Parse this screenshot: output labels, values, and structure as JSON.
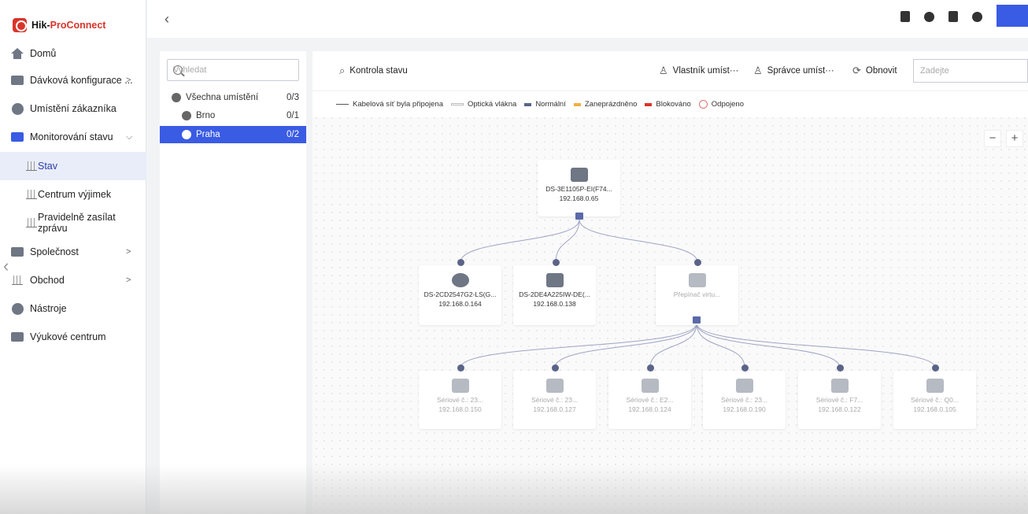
{
  "brand": {
    "hik": "Hik-",
    "pro": "ProConnect"
  },
  "sidebar": {
    "items": [
      {
        "label": "Domů",
        "icon": "home-icon"
      },
      {
        "label": "Dávková konfigurace ...",
        "icon": "batch-config-icon"
      },
      {
        "label": "Umístění zákazníka",
        "icon": "globe-icon"
      },
      {
        "label": "Monitorování stavu",
        "icon": "monitor-icon"
      },
      {
        "label": "Stav",
        "icon": "bar-chart-icon"
      },
      {
        "label": "Centrum výjimek",
        "icon": "bar-chart-icon"
      },
      {
        "label": "Pravidelně zasílat zprávu",
        "icon": "bar-chart-icon"
      },
      {
        "label": "Společnost",
        "icon": "company-icon"
      },
      {
        "label": "Obchod",
        "icon": "shop-icon"
      },
      {
        "label": "Nástroje",
        "icon": "tools-icon"
      },
      {
        "label": "Výukové centrum",
        "icon": "learning-icon"
      }
    ]
  },
  "tree": {
    "search_placeholder": "Vyhledat",
    "rows": [
      {
        "label": "Všechna umístění",
        "count": "0/3"
      },
      {
        "label": "Brno",
        "count": "0/1"
      },
      {
        "label": "Praha",
        "count": "0/2"
      }
    ]
  },
  "toolbar": {
    "health_check": "Kontrola stavu",
    "owner": "Vlastník umíst···",
    "admin": "Správce umíst···",
    "refresh": "Obnovit",
    "input_placeholder": "Zadejte"
  },
  "legend": [
    {
      "label": "Kabelová síť byla připojena",
      "color": "#555555"
    },
    {
      "label": "Optická vlákna",
      "color": "#bbbbbb"
    },
    {
      "label": "Normální",
      "color": "#5b6488"
    },
    {
      "label": "Zaneprázdněno",
      "color": "#f0b040"
    },
    {
      "label": "Blokováno",
      "color": "#d9342b"
    },
    {
      "label": "Odpojeno",
      "color": "#e07070"
    }
  ],
  "zoom": {
    "minus": "−",
    "plus": "+"
  },
  "topology": {
    "root": {
      "name": "DS-3E1105P-EI(F74...",
      "ip": "192.168.0.65"
    },
    "level1": [
      {
        "name": "DS-2CD2547G2-LS(G...",
        "ip": "192.168.0.164"
      },
      {
        "name": "DS-2DE4A225IW-DE(...",
        "ip": "192.168.0.138"
      },
      {
        "name": "Přepínač virtu...",
        "ip": ""
      }
    ],
    "level2": [
      {
        "name": "Sériové č.: 23...",
        "ip": "192.168.0.150"
      },
      {
        "name": "Sériové č.: 23...",
        "ip": "192.168.0.127"
      },
      {
        "name": "Sériové č.: E2...",
        "ip": "192.168.0.124"
      },
      {
        "name": "Sériové č.: 23...",
        "ip": "192.168.0.190"
      },
      {
        "name": "Sériové č.: F7...",
        "ip": "192.168.0.122"
      },
      {
        "name": "Sériové č.: Q0...",
        "ip": "192.168.0.105"
      }
    ]
  }
}
